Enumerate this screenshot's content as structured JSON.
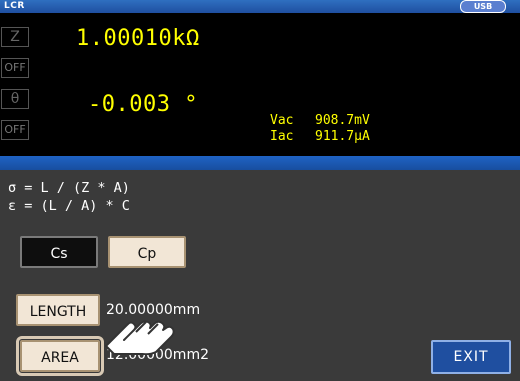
{
  "header": {
    "app_label": "LCR",
    "usb_label": "USB"
  },
  "display": {
    "param1": {
      "symbol": "Z",
      "value": "1.00010kΩ",
      "off_label": "OFF"
    },
    "param2": {
      "symbol": "θ",
      "value": "-0.003 °",
      "off_label": "OFF"
    },
    "monitor": {
      "vac_label": "Vac",
      "vac_value": "908.7mV",
      "iac_label": "Iac",
      "iac_value": "911.7μA"
    }
  },
  "formulas": {
    "sigma": "σ = L / (Z * A)",
    "epsilon": "ε = (L / A) * C"
  },
  "mode_buttons": {
    "cs_label": "Cs",
    "cp_label": "Cp",
    "selected": "Cp"
  },
  "length": {
    "label": "LENGTH",
    "value": "20.00000mm"
  },
  "area": {
    "label": "AREA",
    "value": "12.00000mm2"
  },
  "exit_label": "EXIT",
  "colors": {
    "measurement_text": "#ffff00",
    "accent_blue": "#1f4fa0",
    "panel_bg": "#3a3a3a"
  }
}
